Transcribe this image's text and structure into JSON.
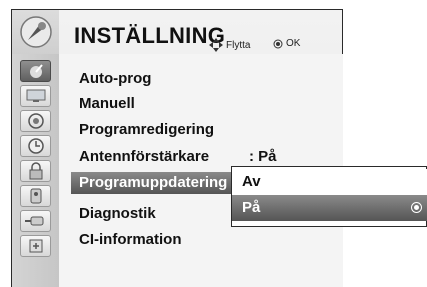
{
  "menu": {
    "title": "INSTÄLLNING",
    "hint_move": "Flytta",
    "hint_ok": "OK",
    "items": [
      {
        "label": "Auto-prog"
      },
      {
        "label": "Manuell"
      },
      {
        "label": "Programredigering"
      },
      {
        "label": "Antennförstärkare"
      },
      {
        "label": "Programuppdatering"
      },
      {
        "label": "Diagnostik"
      },
      {
        "label": "CI-information"
      }
    ],
    "antenna_value": ": På",
    "selected_index": 4
  },
  "popup": {
    "options": [
      {
        "label": "Av",
        "selected": false
      },
      {
        "label": "På",
        "selected": true
      }
    ]
  },
  "icons": [
    "settings-category-icon",
    "antenna-icon",
    "tv-picture-icon",
    "audio-icon",
    "clock-icon",
    "lock-icon",
    "option-icon",
    "input-icon",
    "usb-icon"
  ],
  "colors": {
    "highlight": "#6a6a6a",
    "sidebar": "#cdcdcd",
    "panel": "#f4f4f4"
  }
}
